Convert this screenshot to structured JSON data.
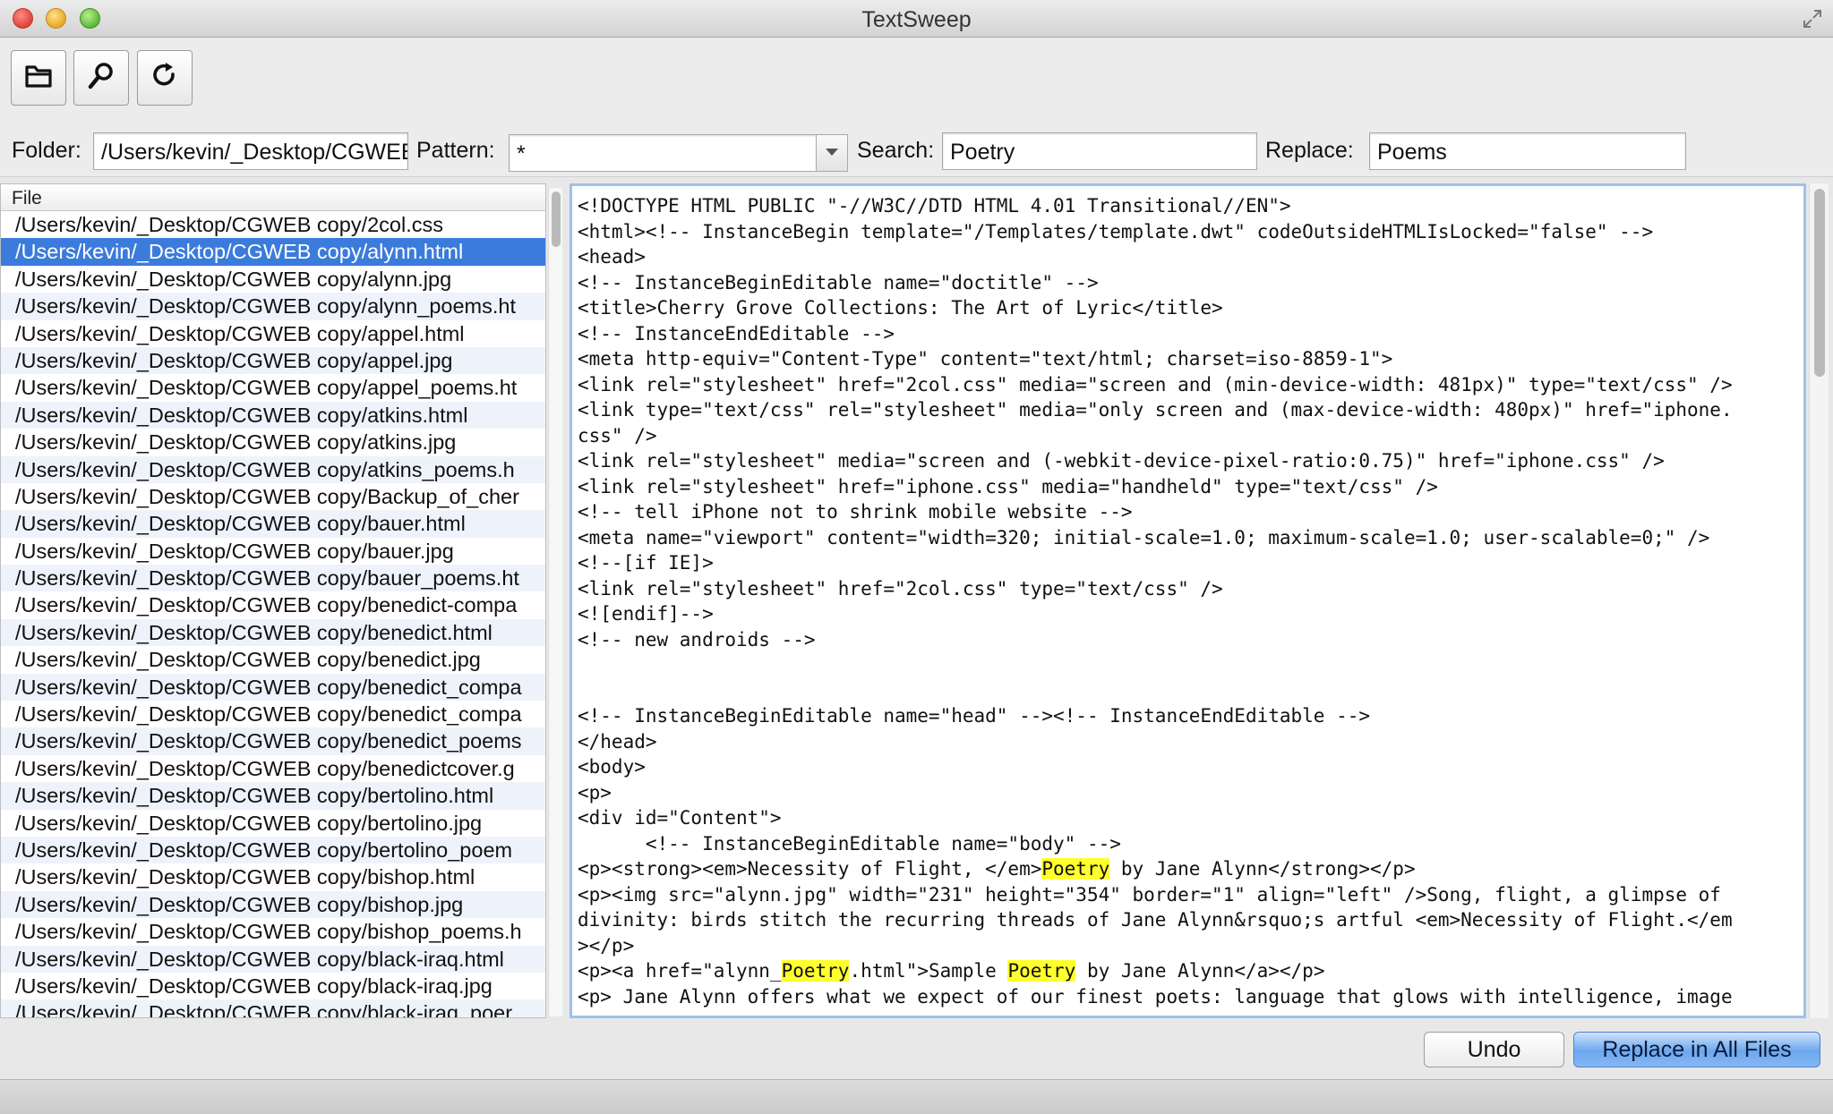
{
  "window": {
    "title": "TextSweep"
  },
  "toolbar": {
    "buttons": [
      {
        "name": "open-folder",
        "icon": "folder-icon"
      },
      {
        "name": "search",
        "icon": "magnifier-icon"
      },
      {
        "name": "refresh",
        "icon": "refresh-icon"
      }
    ]
  },
  "fields": {
    "folder_label": "Folder:",
    "folder_value": "/Users/kevin/_Desktop/CGWEB copy",
    "pattern_label": "Pattern:",
    "pattern_value": "*",
    "search_label": "Search:",
    "search_value": "Poetry",
    "replace_label": "Replace:",
    "replace_value": "Poems"
  },
  "file_list": {
    "header": "File",
    "selected_index": 1,
    "items": [
      "/Users/kevin/_Desktop/CGWEB copy/2col.css",
      "/Users/kevin/_Desktop/CGWEB copy/alynn.html",
      "/Users/kevin/_Desktop/CGWEB copy/alynn.jpg",
      "/Users/kevin/_Desktop/CGWEB copy/alynn_poems.ht",
      "/Users/kevin/_Desktop/CGWEB copy/appel.html",
      "/Users/kevin/_Desktop/CGWEB copy/appel.jpg",
      "/Users/kevin/_Desktop/CGWEB copy/appel_poems.ht",
      "/Users/kevin/_Desktop/CGWEB copy/atkins.html",
      "/Users/kevin/_Desktop/CGWEB copy/atkins.jpg",
      "/Users/kevin/_Desktop/CGWEB copy/atkins_poems.h",
      "/Users/kevin/_Desktop/CGWEB copy/Backup_of_cher",
      "/Users/kevin/_Desktop/CGWEB copy/bauer.html",
      "/Users/kevin/_Desktop/CGWEB copy/bauer.jpg",
      "/Users/kevin/_Desktop/CGWEB copy/bauer_poems.ht",
      "/Users/kevin/_Desktop/CGWEB copy/benedict-compa",
      "/Users/kevin/_Desktop/CGWEB copy/benedict.html",
      "/Users/kevin/_Desktop/CGWEB copy/benedict.jpg",
      "/Users/kevin/_Desktop/CGWEB copy/benedict_compa",
      "/Users/kevin/_Desktop/CGWEB copy/benedict_compa",
      "/Users/kevin/_Desktop/CGWEB copy/benedict_poems",
      "/Users/kevin/_Desktop/CGWEB copy/benedictcover.g",
      "/Users/kevin/_Desktop/CGWEB copy/bertolino.html",
      "/Users/kevin/_Desktop/CGWEB copy/bertolino.jpg",
      "/Users/kevin/_Desktop/CGWEB copy/bertolino_poem",
      "/Users/kevin/_Desktop/CGWEB copy/bishop.html",
      "/Users/kevin/_Desktop/CGWEB copy/bishop.jpg",
      "/Users/kevin/_Desktop/CGWEB copy/bishop_poems.h",
      "/Users/kevin/_Desktop/CGWEB copy/black-iraq.html",
      "/Users/kevin/_Desktop/CGWEB copy/black-iraq.jpg",
      "/Users/kevin/_Desktop/CGWEB copy/black-iraq_poer"
    ]
  },
  "editor": {
    "highlight_color": "#ffff2e",
    "lines": [
      "<!DOCTYPE HTML PUBLIC \"-//W3C//DTD HTML 4.01 Transitional//EN\">",
      "<html><!-- InstanceBegin template=\"/Templates/template.dwt\" codeOutsideHTMLIsLocked=\"false\" -->",
      "<head>",
      "<!-- InstanceBeginEditable name=\"doctitle\" -->",
      "<title>Cherry Grove Collections: The Art of Lyric</title>",
      "<!-- InstanceEndEditable -->",
      "<meta http-equiv=\"Content-Type\" content=\"text/html; charset=iso-8859-1\">",
      "<link rel=\"stylesheet\" href=\"2col.css\" media=\"screen and (min-device-width: 481px)\" type=\"text/css\" />",
      "<link type=\"text/css\" rel=\"stylesheet\" media=\"only screen and (max-device-width: 480px)\" href=\"iphone.",
      "css\" />",
      "<link rel=\"stylesheet\" media=\"screen and (-webkit-device-pixel-ratio:0.75)\" href=\"iphone.css\" />",
      "<link rel=\"stylesheet\" href=\"iphone.css\" media=\"handheld\" type=\"text/css\" />",
      "<!-- tell iPhone not to shrink mobile website -->",
      "<meta name=\"viewport\" content=\"width=320; initial-scale=1.0; maximum-scale=1.0; user-scalable=0;\" />",
      "<!--[if IE]>",
      "<link rel=\"stylesheet\" href=\"2col.css\" type=\"text/css\" />",
      "<![endif]-->",
      "<!-- new androids -->",
      "",
      "",
      "<!-- InstanceBeginEditable name=\"head\" --><!-- InstanceEndEditable -->",
      "</head>",
      "<body>",
      "<p>",
      "<div id=\"Content\">",
      "      <!-- InstanceBeginEditable name=\"body\" -->",
      "<p><strong><em>Necessity of Flight, </em>Poetry by Jane Alynn</strong></p>",
      "<p><img src=\"alynn.jpg\" width=\"231\" height=\"354\" border=\"1\" align=\"left\" />Song, flight, a glimpse of",
      "divinity: birds stitch the recurring threads of Jane Alynn&rsquo;s artful <em>Necessity of Flight.</em",
      "></p>",
      "<p><a href=\"alynn_Poetry.html\">Sample Poetry by Jane Alynn</a></p>",
      "<p> Jane Alynn offers what we expect of our finest poets: language that glows with intelligence, image"
    ]
  },
  "buttons": {
    "undo": "Undo",
    "replace_all": "Replace in All Files"
  }
}
